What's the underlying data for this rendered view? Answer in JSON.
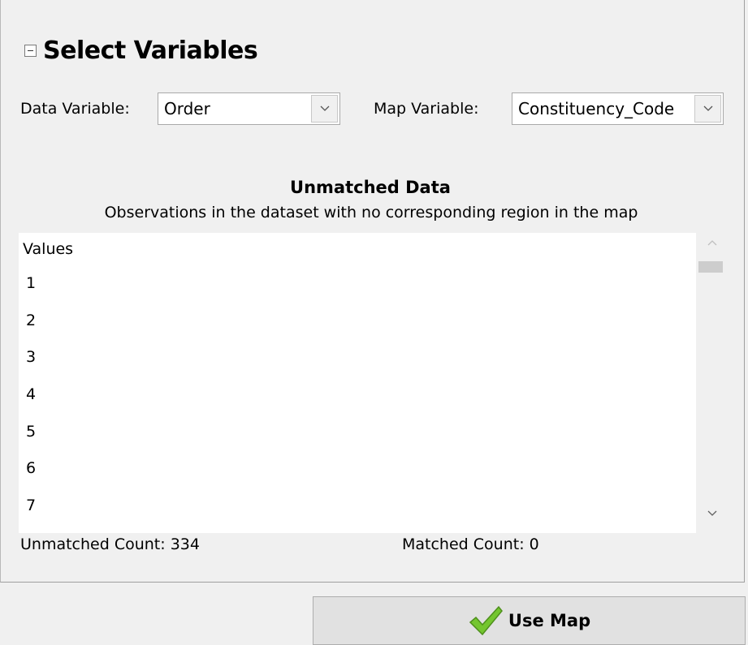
{
  "section": {
    "title": "Select Variables"
  },
  "data_variable": {
    "label": "Data Variable:",
    "value": "Order"
  },
  "map_variable": {
    "label": "Map Variable:",
    "value": "Constituency_Code"
  },
  "unmatched": {
    "title": "Unmatched Data",
    "subtitle": "Observations in the dataset with no corresponding region in the map",
    "column_header": "Values",
    "rows": [
      "1",
      "2",
      "3",
      "4",
      "5",
      "6",
      "7"
    ]
  },
  "counts": {
    "unmatched": "Unmatched Count: 334",
    "matched": "Matched Count: 0"
  },
  "use_map_button": {
    "label": "Use Map",
    "icon": "checkmark-icon",
    "icon_color": "#6dbf2a"
  }
}
